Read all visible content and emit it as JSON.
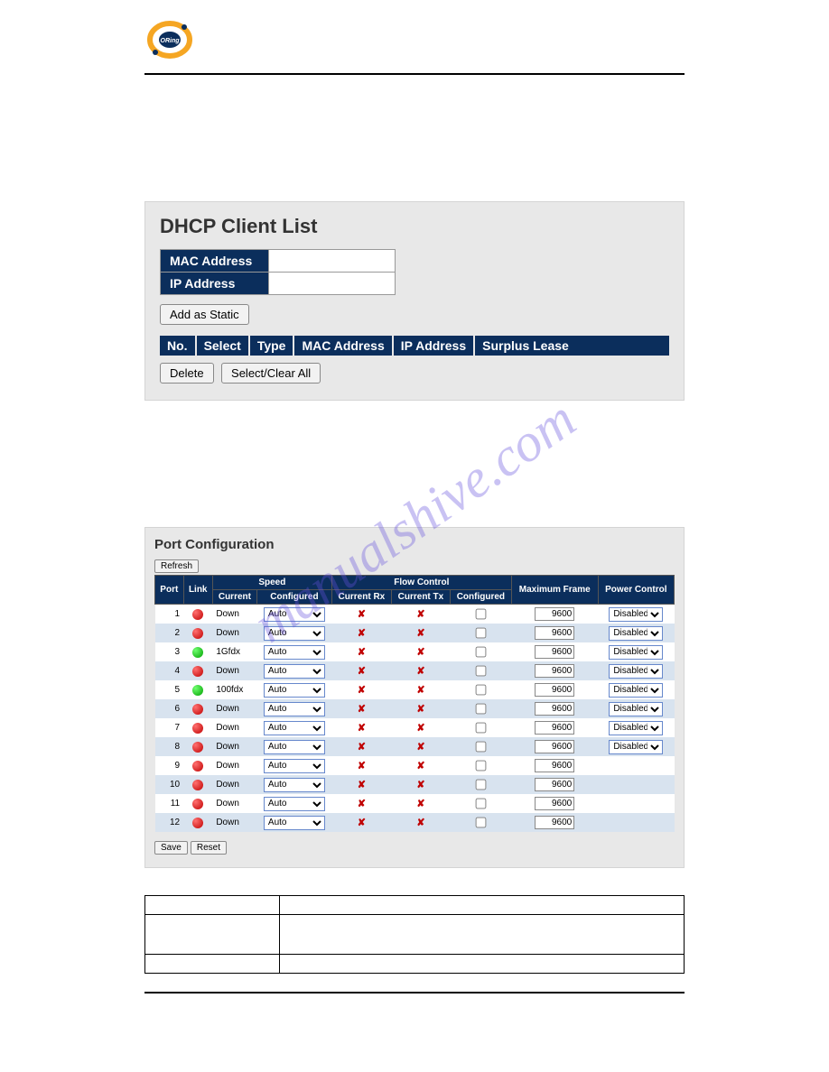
{
  "watermark": "manualshive.com",
  "dhcp": {
    "title": "DHCP Client List",
    "rows": {
      "mac_label": "MAC Address",
      "ip_label": "IP Address"
    },
    "add_btn": "Add as Static",
    "headers": [
      "No.",
      "Select",
      "Type",
      "MAC Address",
      "IP Address",
      "Surplus Lease"
    ],
    "delete_btn": "Delete",
    "selclear_btn": "Select/Clear All"
  },
  "portcfg": {
    "title": "Port Configuration",
    "refresh_btn": "Refresh",
    "headers": {
      "port": "Port",
      "link": "Link",
      "speed": "Speed",
      "speed_current": "Current",
      "speed_conf": "Configured",
      "flow": "Flow Control",
      "flow_rx": "Current Rx",
      "flow_tx": "Current Tx",
      "flow_conf": "Configured",
      "maxframe": "Maximum Frame",
      "power": "Power Control"
    },
    "rows": [
      {
        "port": "1",
        "link": "red",
        "current": "Down",
        "speed": "Auto",
        "rx": "x",
        "tx": "x",
        "conf": false,
        "max": "9600",
        "power": "Disabled"
      },
      {
        "port": "2",
        "link": "red",
        "current": "Down",
        "speed": "Auto",
        "rx": "x",
        "tx": "x",
        "conf": false,
        "max": "9600",
        "power": "Disabled"
      },
      {
        "port": "3",
        "link": "green",
        "current": "1Gfdx",
        "speed": "Auto",
        "rx": "x",
        "tx": "x",
        "conf": false,
        "max": "9600",
        "power": "Disabled"
      },
      {
        "port": "4",
        "link": "red",
        "current": "Down",
        "speed": "Auto",
        "rx": "x",
        "tx": "x",
        "conf": false,
        "max": "9600",
        "power": "Disabled"
      },
      {
        "port": "5",
        "link": "green",
        "current": "100fdx",
        "speed": "Auto",
        "rx": "x",
        "tx": "x",
        "conf": false,
        "max": "9600",
        "power": "Disabled"
      },
      {
        "port": "6",
        "link": "red",
        "current": "Down",
        "speed": "Auto",
        "rx": "x",
        "tx": "x",
        "conf": false,
        "max": "9600",
        "power": "Disabled"
      },
      {
        "port": "7",
        "link": "red",
        "current": "Down",
        "speed": "Auto",
        "rx": "x",
        "tx": "x",
        "conf": false,
        "max": "9600",
        "power": "Disabled"
      },
      {
        "port": "8",
        "link": "red",
        "current": "Down",
        "speed": "Auto",
        "rx": "x",
        "tx": "x",
        "conf": false,
        "max": "9600",
        "power": "Disabled"
      },
      {
        "port": "9",
        "link": "red",
        "current": "Down",
        "speed": "Auto",
        "rx": "x",
        "tx": "x",
        "conf": false,
        "max": "9600",
        "power": ""
      },
      {
        "port": "10",
        "link": "red",
        "current": "Down",
        "speed": "Auto",
        "rx": "x",
        "tx": "x",
        "conf": false,
        "max": "9600",
        "power": ""
      },
      {
        "port": "11",
        "link": "red",
        "current": "Down",
        "speed": "Auto",
        "rx": "x",
        "tx": "x",
        "conf": false,
        "max": "9600",
        "power": ""
      },
      {
        "port": "12",
        "link": "red",
        "current": "Down",
        "speed": "Auto",
        "rx": "x",
        "tx": "x",
        "conf": false,
        "max": "9600",
        "power": ""
      }
    ],
    "save_btn": "Save",
    "reset_btn": "Reset"
  },
  "desc": {
    "r1": {
      "label": "",
      "text": ""
    },
    "r2": {
      "label": "",
      "text": ""
    },
    "r3": {
      "label": "",
      "text": ""
    }
  }
}
